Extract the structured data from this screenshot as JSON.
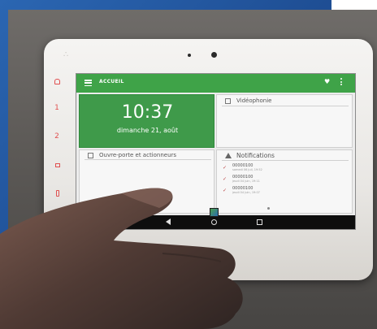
{
  "colors": {
    "accent_green": "#3fa348",
    "clock_green": "#3f9a4a",
    "side_button_red": "#e05050",
    "background_blue": "#1f4f95"
  },
  "device": {
    "side_buttons": [
      "1",
      "2"
    ],
    "side_icons": [
      "bell-icon",
      "envelope-icon",
      "door-icon",
      "key-icon"
    ]
  },
  "app": {
    "title": "ACCUEIL",
    "icons": [
      "menu-icon",
      "heart-icon",
      "more-vert-icon"
    ]
  },
  "clock": {
    "time": "10:37",
    "date": "dimanche 21, août"
  },
  "tiles": {
    "videophonie": {
      "title": "Vidéophonie",
      "icon": "camera-icon"
    },
    "ouvre_porte": {
      "title": "Ouvre-porte et actionneurs",
      "icon": "door-icon"
    },
    "notifications": {
      "title": "Notifications",
      "icon": "warning-icon",
      "items": [
        {
          "number": "00000100",
          "detail": "samedi 06 juil, 19:52"
        },
        {
          "number": "00000100",
          "detail": "jeudi 04 juin, 19:11"
        },
        {
          "number": "00000100",
          "detail": "jeudi 04 juin, 19:07"
        }
      ]
    }
  },
  "navbar": {
    "icons": [
      "back-icon",
      "home-icon",
      "recent-apps-icon"
    ]
  }
}
